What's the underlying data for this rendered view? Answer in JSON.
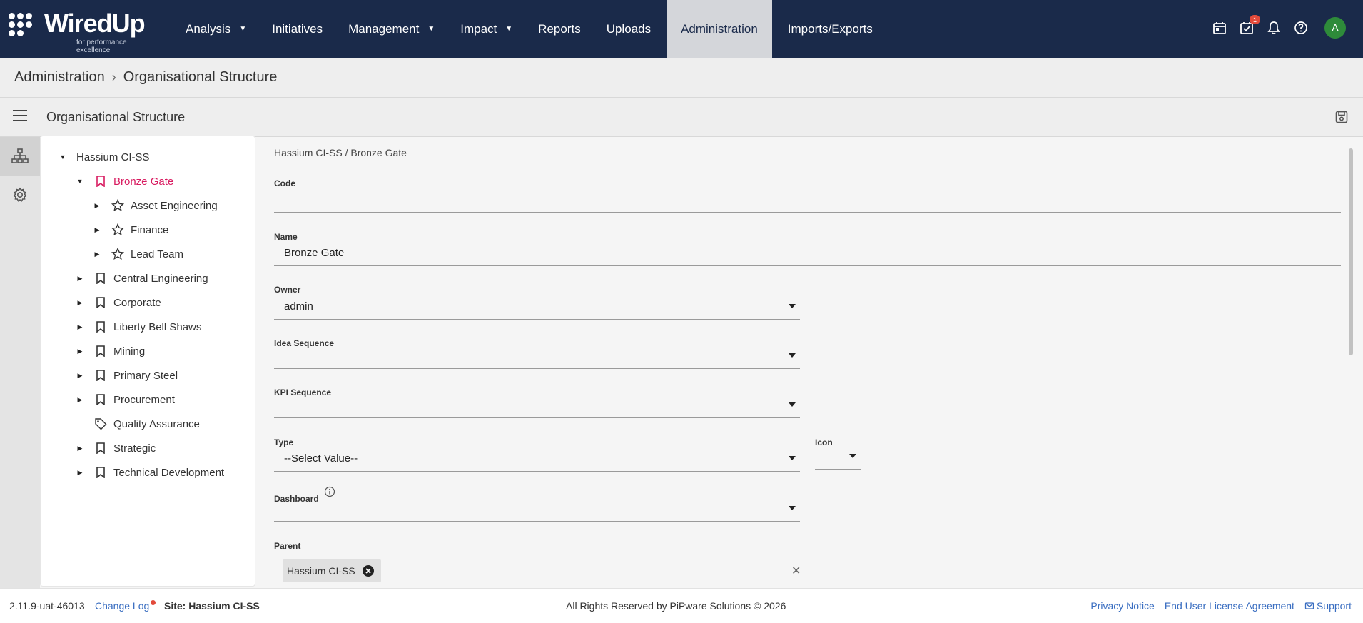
{
  "app": {
    "logo_text": "WiredUp",
    "logo_tagline": "for performance excellence"
  },
  "nav": {
    "items": [
      {
        "label": "Analysis",
        "has_caret": true
      },
      {
        "label": "Initiatives",
        "has_caret": false
      },
      {
        "label": "Management",
        "has_caret": true
      },
      {
        "label": "Impact",
        "has_caret": true
      },
      {
        "label": "Reports",
        "has_caret": false
      },
      {
        "label": "Uploads",
        "has_caret": false
      },
      {
        "label": "Administration",
        "has_caret": false,
        "active": true
      },
      {
        "label": "Imports/Exports",
        "has_caret": false
      }
    ],
    "tasks_badge": "1",
    "avatar_initial": "A",
    "colors": {
      "bar": "#1a2a4a",
      "active_tab": "#d4d6da",
      "badge": "#e24a3b",
      "avatar": "#2e8b3a"
    }
  },
  "breadcrumb": {
    "root": "Administration",
    "current": "Organisational Structure"
  },
  "section": {
    "title": "Organisational Structure"
  },
  "tree": {
    "nodes": [
      {
        "label": "Hassium CI-SS",
        "expanded": true,
        "icon": "none"
      },
      {
        "label": "Bronze Gate",
        "expanded": true,
        "icon": "bookmark-icon",
        "selected": true
      },
      {
        "label": "Asset Engineering",
        "expanded": false,
        "icon": "star-icon"
      },
      {
        "label": "Finance",
        "expanded": false,
        "icon": "star-icon"
      },
      {
        "label": "Lead Team",
        "expanded": false,
        "icon": "star-icon"
      },
      {
        "label": "Central Engineering",
        "expanded": false,
        "icon": "bookmark-icon"
      },
      {
        "label": "Corporate",
        "expanded": false,
        "icon": "bookmark-icon"
      },
      {
        "label": "Liberty Bell Shaws",
        "expanded": false,
        "icon": "bookmark-icon"
      },
      {
        "label": "Mining",
        "expanded": false,
        "icon": "bookmark-icon"
      },
      {
        "label": "Primary Steel",
        "expanded": false,
        "icon": "bookmark-icon"
      },
      {
        "label": "Procurement",
        "expanded": false,
        "icon": "bookmark-icon"
      },
      {
        "label": "Quality Assurance",
        "expanded": false,
        "icon": "tag-icon"
      },
      {
        "label": "Strategic",
        "expanded": false,
        "icon": "bookmark-icon"
      },
      {
        "label": "Technical Development",
        "expanded": false,
        "icon": "bookmark-icon"
      }
    ],
    "selected_color": "#d81b60"
  },
  "form": {
    "path": "Hassium CI-SS / Bronze Gate",
    "code_label": "Code",
    "code_value": "",
    "name_label": "Name",
    "name_value": "Bronze Gate",
    "owner_label": "Owner",
    "owner_value": "admin",
    "idea_sequence_label": "Idea Sequence",
    "idea_sequence_value": "",
    "kpi_sequence_label": "KPI Sequence",
    "kpi_sequence_value": "",
    "type_label": "Type",
    "type_value": "--Select Value--",
    "icon_label": "Icon",
    "icon_value": "",
    "dashboard_label": "Dashboard",
    "dashboard_value": "",
    "parent_label": "Parent",
    "parent_chip": "Hassium CI-SS"
  },
  "footer": {
    "version": "2.11.9-uat-46013",
    "change_log": "Change Log",
    "site": "Site: Hassium CI-SS",
    "rights": "All Rights Reserved by PiPware Solutions © 2026",
    "privacy": "Privacy Notice",
    "eula": "End User License Agreement",
    "support": "Support"
  }
}
